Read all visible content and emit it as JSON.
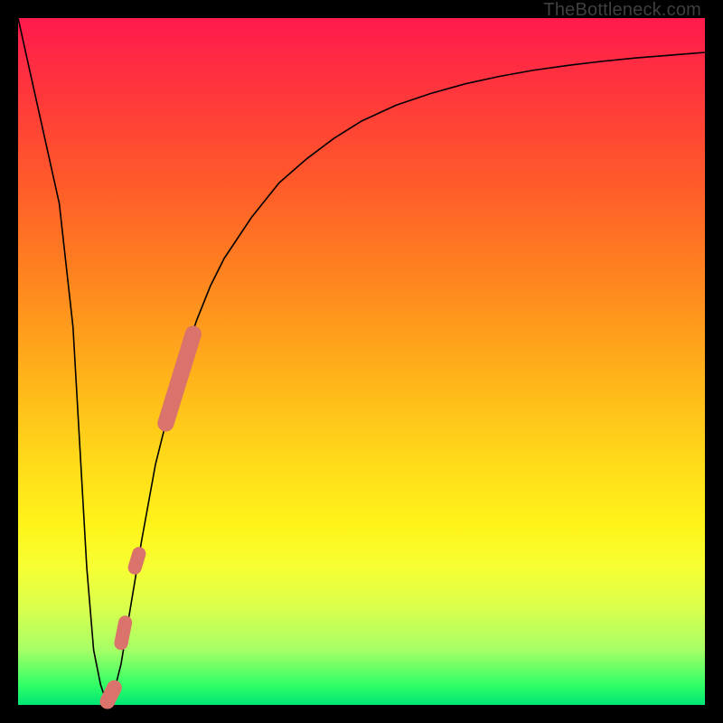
{
  "watermark": "TheBottleneck.com",
  "colors": {
    "curve": "#000000",
    "marker": "#d9736b",
    "frame": "#000000"
  },
  "chart_data": {
    "type": "line",
    "title": "",
    "xlabel": "",
    "ylabel": "",
    "xlim": [
      0,
      100
    ],
    "ylim": [
      0,
      100
    ],
    "series": [
      {
        "name": "bottleneck-curve",
        "x": [
          0,
          2,
          4,
          6,
          8,
          10,
          11,
          12,
          13,
          14,
          15,
          16,
          18,
          20,
          22,
          24,
          26,
          28,
          30,
          34,
          38,
          42,
          46,
          50,
          55,
          60,
          65,
          70,
          75,
          80,
          85,
          90,
          95,
          100
        ],
        "y": [
          100,
          91,
          82,
          73,
          55,
          20,
          8,
          3,
          0,
          2,
          6,
          12,
          24,
          35,
          43,
          50,
          56,
          61,
          65,
          71,
          76,
          79.5,
          82.5,
          85,
          87.3,
          89,
          90.4,
          91.5,
          92.4,
          93.1,
          93.7,
          94.2,
          94.6,
          95
        ]
      }
    ],
    "markers": [
      {
        "name": "highlight-upper",
        "x1": 21.5,
        "y1": 41,
        "x2": 25.5,
        "y2": 54,
        "width": 2.4
      },
      {
        "name": "highlight-lower-dot1",
        "x1": 17.0,
        "y1": 20,
        "x2": 17.6,
        "y2": 22,
        "width": 2.0
      },
      {
        "name": "highlight-lower-dot2",
        "x1": 15.0,
        "y1": 9,
        "x2": 15.6,
        "y2": 12,
        "width": 2.0
      },
      {
        "name": "highlight-min",
        "x1": 13.0,
        "y1": 0.5,
        "x2": 14.0,
        "y2": 2.5,
        "width": 2.2
      }
    ]
  }
}
